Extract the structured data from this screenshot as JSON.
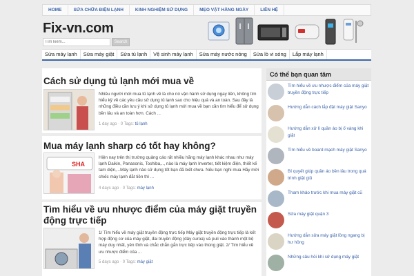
{
  "topnav": [
    "HOME",
    "SỬA CHỮA ĐIỆN LẠNH",
    "KINH NGHIỆM SỬ DỤNG",
    "MẸO VẶT HẰNG NGÀY",
    "LIÊN HỆ"
  ],
  "header": {
    "logo": "Fix-vn.com",
    "search_placeholder": "Tìm kiếm...",
    "search_button": "Search"
  },
  "catnav": [
    "Sửa máy lạnh",
    "Sửa máy giặt",
    "Sửa tủ lạnh",
    "Vệ sinh máy lạnh",
    "Sửa máy nước nóng",
    "Sửa lò vi sóng",
    "Lắp máy lạnh"
  ],
  "articles": [
    {
      "title": "Cách sử dụng tủ lạnh mới mua về",
      "excerpt": "Nhiều người mới mua tủ lạnh về là cho nó vận hành sử dụng ngay liền, không tìm hiểu kỹ về các yêu cầu sử dụng tủ lạnh sao cho hiệu quả và an toàn. Sau đây là những điều cần lưu ý khi sử dụng tủ lạnh mới mua về bạn cần tìm hiểu để sử dụng bền lâu và an toàn hơn. Cách ...",
      "meta": "1 day ago  ·  0  Tags: ",
      "tag": "tủ lạnh"
    },
    {
      "title": "Mua máy lạnh sharp có tốt hay không?",
      "excerpt": "Hiện nay trên thị trường quảng cáo rất nhiều hãng máy lạnh khác nhau như máy lạnh Daikin, Panasonic, Toshiba,.., nào là máy lạnh Inverter, tiết kiệm điện, thiết kế tam diện,...Máy lạnh nào sử dụng tốt bạn đã biết chưa. Nếu bạn nghi mua Hãy mời chiếc máy lạnh đắt tiền thì ...",
      "meta": "4 days ago  ·  0  Tags: ",
      "tag": "máy lạnh"
    },
    {
      "title": "Tìm hiểu về ưu nhược điểm của máy giặt truyền động trực tiếp",
      "excerpt": "1/ Tìm hiểu về máy giặt truyền động trực tiếp Máy giặt truyền động trực tiếp là kết hợp động cơ của máy giặt, đai truyền động (dây curoa) và puli vào thành một bộ máy duy nhất, yên tĩnh và chắc chắn gắn trực tiếp vào thùng giặt. 2/ Tìm hiểu về ưu nhược điểm của ...",
      "meta": "5 days ago  ·  0  Tags: ",
      "tag": "máy giặt"
    }
  ],
  "sidebar": {
    "title": "Có thể bạn quan tâm",
    "items": [
      "Tìm hiểu về ưu nhược điểm của máy giặt truyền động trực tiếp",
      "Hướng dẫn cách lắp đặt máy giặt Sanyo",
      "Hướng dẫn xử lí quần áo bị ố vàng khi giặt",
      "Tìm hiểu về board mạch máy giặt Sanyo",
      "Bí quyết giúp quần áo bền lâu trong quá trình giặt giũ",
      "Tham khảo trước khi mua máy giặt cũ",
      "Sửa máy giặt quận 3",
      "Hướng dẫn sửa máy giặt lồng ngang bị hư hỏng",
      "Những câu hỏi khi sử dụng máy giặt"
    ]
  },
  "colors": {
    "accent": "#3a63a8",
    "background": "#ececec"
  }
}
